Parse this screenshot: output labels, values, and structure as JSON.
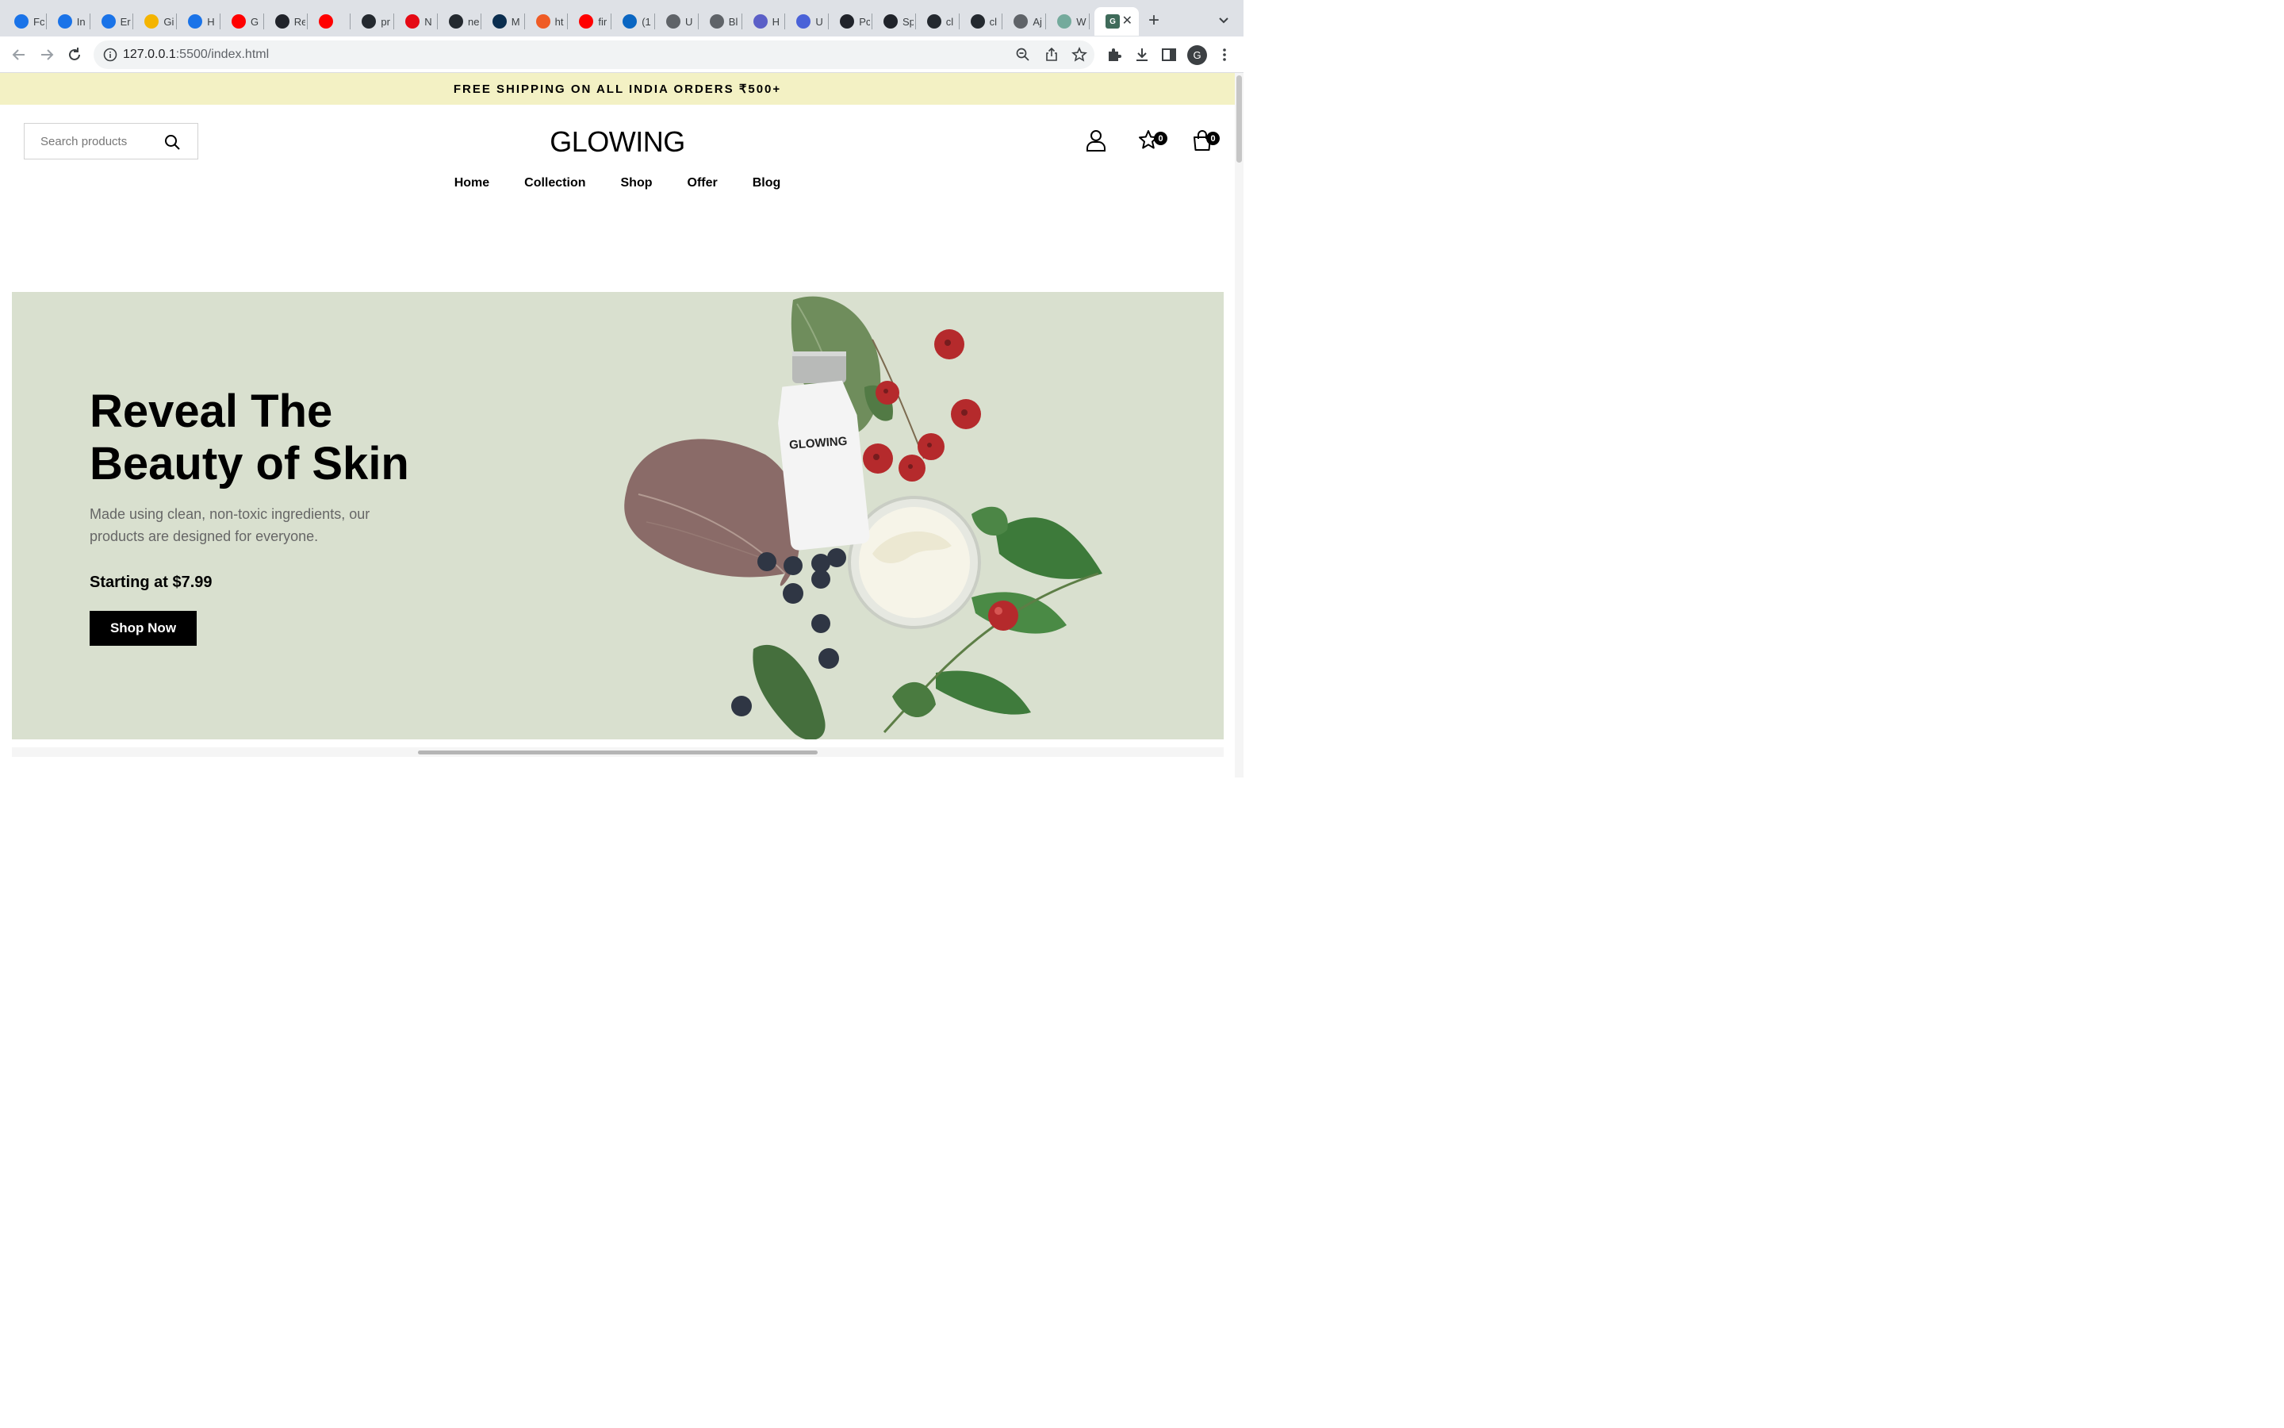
{
  "browser": {
    "tabs": [
      {
        "label": "Fc",
        "icon": "chrome-icon",
        "color": "#1a73e8"
      },
      {
        "label": "In",
        "icon": "chrome-icon",
        "color": "#1a73e8"
      },
      {
        "label": "Er",
        "icon": "chrome-icon",
        "color": "#1a73e8"
      },
      {
        "label": "Gi",
        "icon": "slides-icon",
        "color": "#f4b400"
      },
      {
        "label": "H",
        "icon": "chrome-icon",
        "color": "#1a73e8"
      },
      {
        "label": "G",
        "icon": "youtube-icon",
        "color": "#ff0000"
      },
      {
        "label": "Re",
        "icon": "react-icon",
        "color": "#20232a"
      },
      {
        "label": "",
        "icon": "youtube-icon",
        "color": "#ff0000"
      },
      {
        "label": "pr",
        "icon": "github-icon",
        "color": "#24292f"
      },
      {
        "label": "N",
        "icon": "netflix-icon",
        "color": "#e50914"
      },
      {
        "label": "ne",
        "icon": "github-icon",
        "color": "#24292f"
      },
      {
        "label": "M",
        "icon": "app-icon",
        "color": "#0b2e4f"
      },
      {
        "label": "ht",
        "icon": "postman-icon",
        "color": "#ef5b25"
      },
      {
        "label": "fir",
        "icon": "youtube-icon",
        "color": "#ff0000"
      },
      {
        "label": "(1",
        "icon": "linkedin-icon",
        "color": "#0a66c2"
      },
      {
        "label": "U",
        "icon": "globe-icon",
        "color": "#5f6368"
      },
      {
        "label": "Bl",
        "icon": "globe-icon",
        "color": "#5f6368"
      },
      {
        "label": "H",
        "icon": "app-icon",
        "color": "#5b5fc7"
      },
      {
        "label": "U",
        "icon": "app-icon",
        "color": "#4a62d8"
      },
      {
        "label": "Pc",
        "icon": "react-icon",
        "color": "#20232a"
      },
      {
        "label": "Sp",
        "icon": "react-icon",
        "color": "#20232a"
      },
      {
        "label": "cl",
        "icon": "github-icon",
        "color": "#24292f"
      },
      {
        "label": "cl",
        "icon": "github-icon",
        "color": "#24292f"
      },
      {
        "label": "Aj",
        "icon": "globe-icon",
        "color": "#5f6368"
      },
      {
        "label": "W",
        "icon": "chatgpt-icon",
        "color": "#74aa9c"
      }
    ],
    "active_tab": {
      "icon": "glowing-favicon",
      "letter": "G",
      "color": "#3f6b5a"
    },
    "url_host": "127.0.0.1",
    "url_rest": ":5500/index.html",
    "profile_initial": "G"
  },
  "announcement": "FREE SHIPPING ON ALL INDIA ORDERS ₹500+",
  "header": {
    "search_placeholder": "Search products",
    "logo": "GLOWING",
    "wishlist_count": "0",
    "cart_count": "0"
  },
  "nav": [
    "Home",
    "Collection",
    "Shop",
    "Offer",
    "Blog"
  ],
  "hero": {
    "title": "Reveal The Beauty of Skin",
    "text": "Made using clean, non-toxic ingredients, our products are designed for everyone.",
    "price": "Starting at $7.99",
    "button": "Shop Now",
    "bottle_label": "GLOWING",
    "background": "#d9e0cf"
  }
}
